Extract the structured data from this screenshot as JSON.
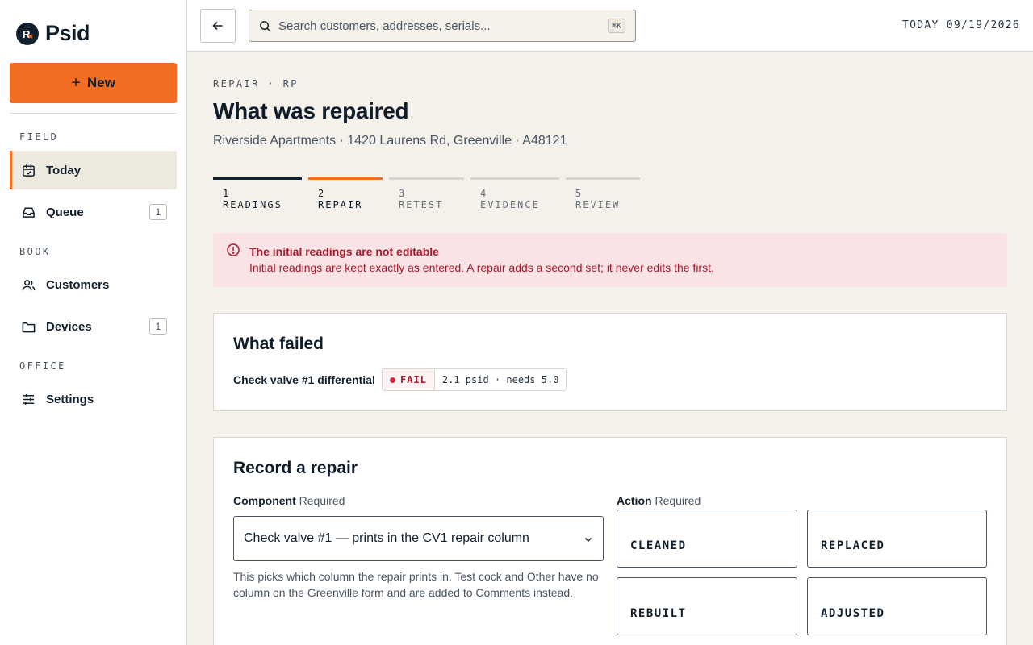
{
  "sidebar": {
    "brand": "Psid",
    "new_label": "New",
    "sections": [
      {
        "label": "FIELD",
        "items": [
          {
            "label": "Today",
            "icon": "calendar-check-icon",
            "active": true
          },
          {
            "label": "Queue",
            "icon": "inbox-icon",
            "badge": "1"
          }
        ]
      },
      {
        "label": "BOOK",
        "items": [
          {
            "label": "Customers",
            "icon": "users-icon"
          },
          {
            "label": "Devices",
            "icon": "folder-icon",
            "badge": "1"
          }
        ]
      },
      {
        "label": "OFFICE",
        "items": [
          {
            "label": "Settings",
            "icon": "sliders-icon"
          }
        ]
      }
    ]
  },
  "topbar": {
    "search_placeholder": "Search customers, addresses, serials...",
    "shortcut": "⌘K",
    "today": "TODAY 09/19/2026"
  },
  "page": {
    "eyebrow": "REPAIR · RP",
    "title": "What was repaired",
    "subtitle": "Riverside Apartments · 1420 Laurens Rd, Greenville · A48121"
  },
  "steps": [
    {
      "label": "1 READINGS",
      "state": "done"
    },
    {
      "label": "2 REPAIR",
      "state": "current"
    },
    {
      "label": "3 RETEST",
      "state": "todo"
    },
    {
      "label": "4 EVIDENCE",
      "state": "todo"
    },
    {
      "label": "5 REVIEW",
      "state": "todo"
    }
  ],
  "alert": {
    "title": "The initial readings are not editable",
    "body": "Initial readings are kept exactly as entered. A repair adds a second set; it never edits the first."
  },
  "failed": {
    "title": "What failed",
    "label": "Check valve #1 differential",
    "status": "FAIL",
    "value": "2.1 psid · needs 5.0"
  },
  "repair": {
    "title": "Record a repair",
    "component_label": "Component",
    "action_label": "Action",
    "required": "Required",
    "component_value": "Check valve #1 — prints in the CV1 repair column",
    "help": "This picks which column the repair prints in. Test cock and Other have no column on the Greenville form and are added to Comments instead.",
    "actions": [
      "CLEANED",
      "REPLACED",
      "REBUILT",
      "ADJUSTED"
    ]
  },
  "colors": {
    "accent": "#f26d21",
    "ink": "#13202e",
    "error": "#a8192a",
    "background": "#f4f1ea"
  }
}
